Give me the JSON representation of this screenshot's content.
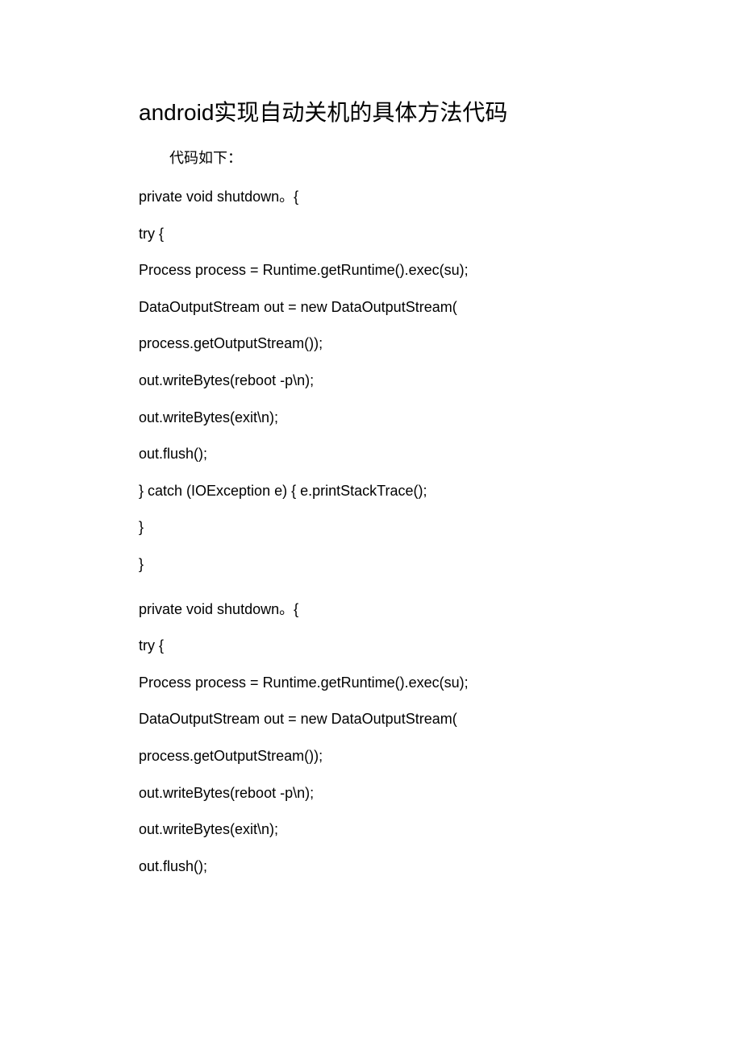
{
  "title": "android实现自动关机的具体方法代码",
  "intro": "代码如下：",
  "block1": {
    "l1a": "private void shutdown",
    "l1b": "。",
    "l1c": "{",
    "l2": "try {",
    "l3": "Process process = Runtime.getRuntime().exec(su);",
    "l4": "DataOutputStream out = new DataOutputStream(",
    "l5": "process.getOutputStream());",
    "l6": "out.writeBytes(reboot -p\\n);",
    "l7": "out.writeBytes(exit\\n);",
    "l8": "out.flush();",
    "l9": "} catch (IOException e) { e.printStackTrace();",
    "l10": "}",
    "l11": "}"
  },
  "block2": {
    "l1a": "private void shutdown",
    "l1b": "。",
    "l1c": "{",
    "l2": "try {",
    "l3": "Process process = Runtime.getRuntime().exec(su);",
    "l4": "DataOutputStream out = new DataOutputStream(",
    "l5": "process.getOutputStream());",
    "l6": "out.writeBytes(reboot -p\\n);",
    "l7": "out.writeBytes(exit\\n);",
    "l8": "out.flush();"
  }
}
